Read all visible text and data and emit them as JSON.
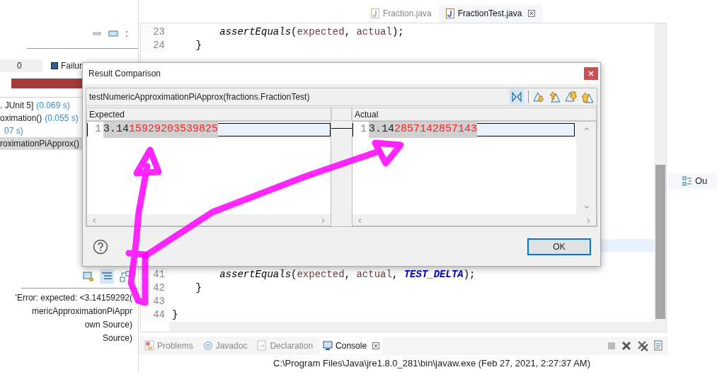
{
  "editor_tabs": [
    {
      "label": "Fraction.java",
      "selected": false,
      "closable": false
    },
    {
      "label": "FractionTest.java",
      "selected": true,
      "closable": true
    }
  ],
  "junit_panel": {
    "counters": [
      {
        "value": "0"
      },
      {
        "label": "Failur"
      }
    ],
    "progress": {
      "level": 1,
      "failed": true
    },
    "test_tree": [
      {
        "name": ". JUnit 5]",
        "time": "(0.069 s)",
        "selected": false
      },
      {
        "name": "oximation()",
        "time": "(0.055 s)",
        "selected": false
      },
      {
        "time": "07 s)",
        "selected": false
      },
      {
        "name": "roximationPiApprox()",
        "selected": true
      }
    ],
    "failure_trace": [
      "'Error: expected: <3.14159292(",
      "mericApproximationPiAppr",
      "own Source)",
      "Source)"
    ]
  },
  "editor": {
    "lines_top": [
      {
        "number": "23",
        "tokens": [
          {
            "text": "        assertEquals",
            "kind": "method"
          },
          {
            "text": "(",
            "kind": "plain"
          },
          {
            "text": "expected",
            "kind": "variable"
          },
          {
            "text": ", ",
            "kind": "plain"
          },
          {
            "text": "actual",
            "kind": "variable"
          },
          {
            "text": ");",
            "kind": "plain"
          }
        ]
      },
      {
        "number": "24",
        "tokens": [
          {
            "text": "    }",
            "kind": "plain"
          }
        ]
      }
    ],
    "lines_bottom": [
      {
        "number": "41",
        "tokens": [
          {
            "text": "        assertEquals",
            "kind": "method"
          },
          {
            "text": "(",
            "kind": "plain"
          },
          {
            "text": "expected",
            "kind": "variable"
          },
          {
            "text": ", ",
            "kind": "plain"
          },
          {
            "text": "actual",
            "kind": "variable"
          },
          {
            "text": ", ",
            "kind": "plain"
          },
          {
            "text": "TEST_DELTA",
            "kind": "constant"
          },
          {
            "text": ");",
            "kind": "plain"
          }
        ]
      },
      {
        "number": "42",
        "tokens": [
          {
            "text": "    }",
            "kind": "plain"
          }
        ]
      },
      {
        "number": "43"
      },
      {
        "number": "44",
        "tokens": [
          {
            "text": "}",
            "kind": "plain"
          }
        ]
      }
    ]
  },
  "dialog": {
    "title": "Result Comparison",
    "test_name": "testNumericApproximationPiApprox(fractions.FractionTest)",
    "panes": [
      {
        "label": "Expected",
        "line_number": "1",
        "same": "3.14",
        "diff": "15929203539825"
      },
      {
        "label": "Actual",
        "line_number": "1",
        "same": "3.14",
        "diff": "2857142857143"
      }
    ],
    "button": "OK"
  },
  "bottom_tabs": [
    {
      "label": "Problems",
      "selected": false,
      "closable": false
    },
    {
      "label": "Javadoc",
      "selected": false,
      "closable": false
    },
    {
      "label": "Declaration",
      "selected": false,
      "closable": false
    },
    {
      "label": "Console",
      "selected": true,
      "closable": true
    }
  ],
  "console": {
    "text": "C:\\Program Files\\Java\\jre1.8.0_281\\bin\\javaw.exe (Feb 27, 2021, 2:27:37 AM)"
  },
  "outline_tab": {
    "label": "Ou"
  }
}
